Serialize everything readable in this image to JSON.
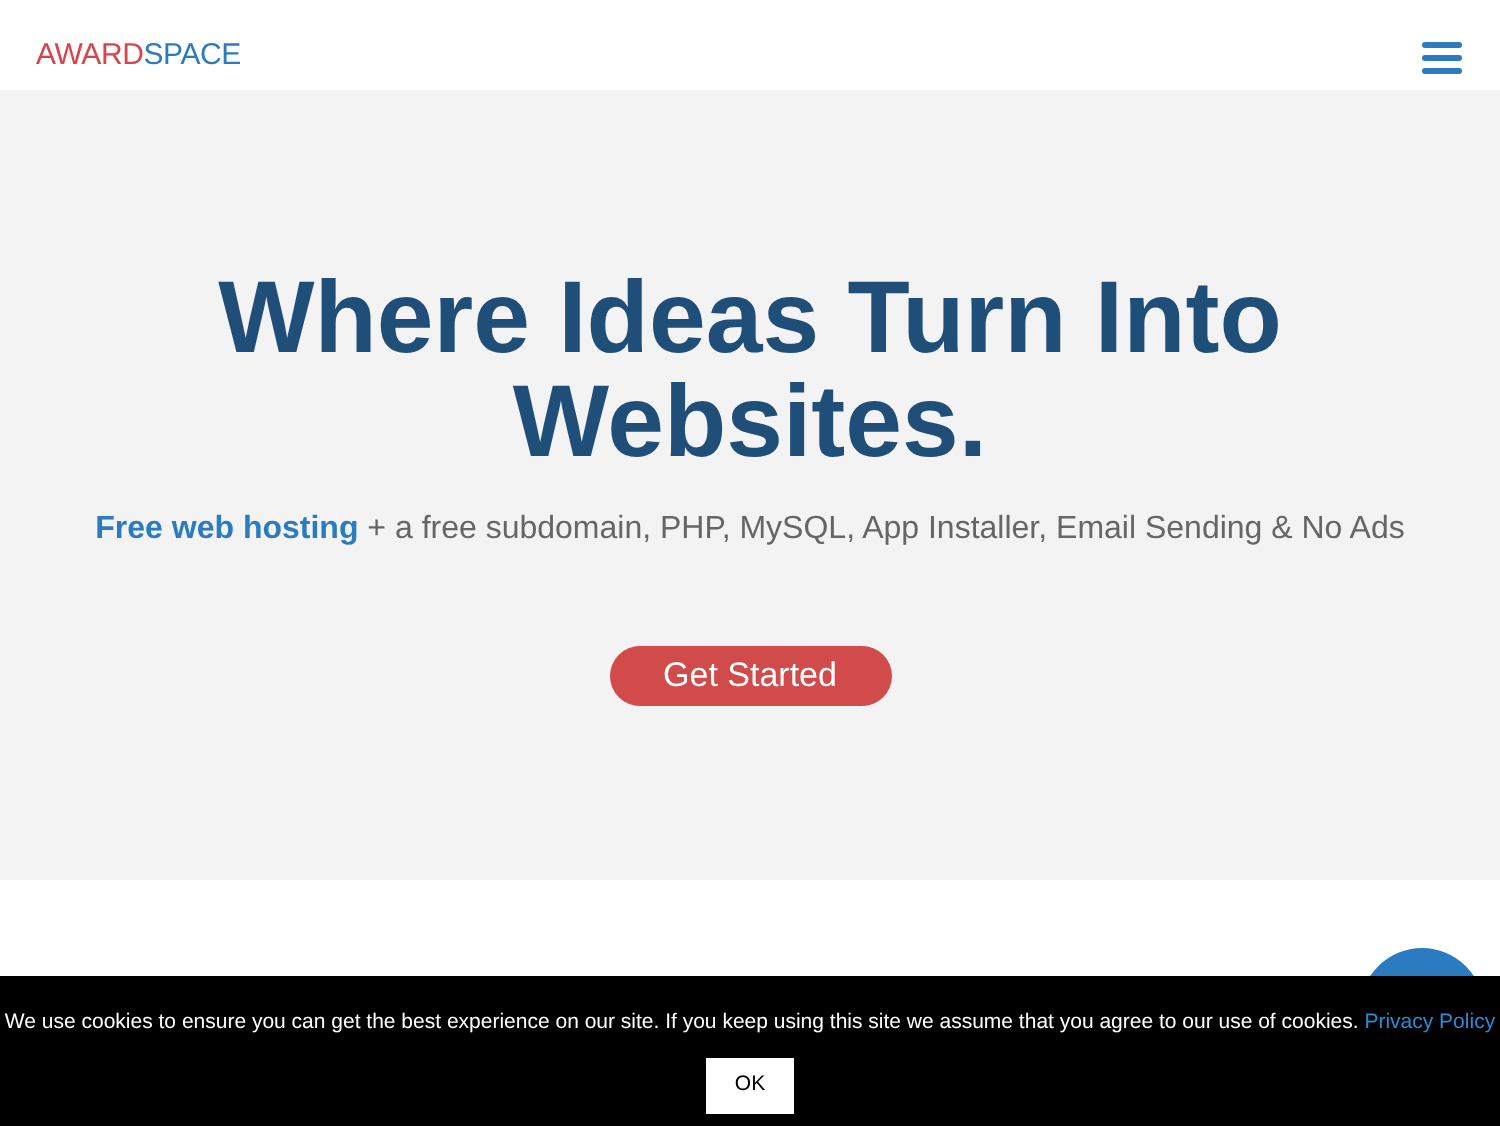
{
  "header": {
    "logo": [
      {
        "text": "AWARD",
        "color": "#d9434a"
      },
      {
        "text": "SPACE",
        "color": "#2a7bbf"
      }
    ]
  },
  "hero": {
    "title": "Where Ideas Turn Into Websites.",
    "subtitle": "**Free web hosting** + a free subdomain, PHP, MySQL, App Installer, Email Sending & No Ads",
    "button": "Get Started"
  },
  "cookie_bar": {
    "message": "We use cookies to ensure you can get the best experience on our site. If you keep using this site we assume that you agree to our use of cookies.",
    "link": "Privacy Policy",
    "button": "OK"
  }
}
